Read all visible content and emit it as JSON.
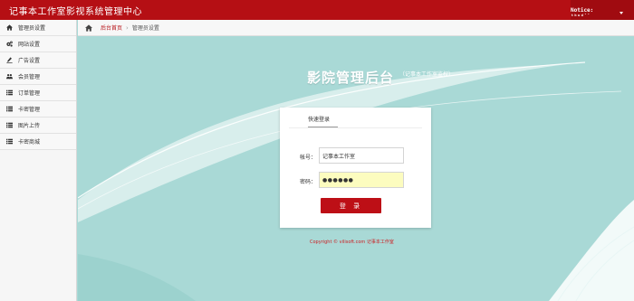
{
  "topbar": {
    "title": "记事本工作室影视系统管理中心",
    "notice": "Notice:　ᵗʰᵘᵈ˙˙"
  },
  "sidebar": {
    "items": [
      {
        "label": "管理员设置",
        "icon": "home-icon"
      },
      {
        "label": "网站设置",
        "icon": "gears-icon"
      },
      {
        "label": "广告设置",
        "icon": "pen-icon"
      },
      {
        "label": "会员管理",
        "icon": "users-icon"
      },
      {
        "label": "订单管理",
        "icon": "list-icon"
      },
      {
        "label": "卡密管理",
        "icon": "list-icon"
      },
      {
        "label": "图片上传",
        "icon": "list-icon"
      },
      {
        "label": "卡密商城",
        "icon": "list-icon"
      }
    ]
  },
  "breadcrumb": {
    "home_link": "后台首页",
    "separator": "›",
    "current": "管理员设置"
  },
  "login": {
    "heading": "影院管理后台",
    "subheading": "（记事本工作室监权）",
    "tab": "快速登录",
    "username_label": "帐号：",
    "username_value": "记事本工作室",
    "password_label": "密码：",
    "password_value": "●●●●●●",
    "submit": "登 录"
  },
  "footer": {
    "copyright": "Copyright © vilisoft.com 记事本工作室"
  },
  "colors": {
    "brand_red": "#b50f14",
    "background_teal": "#a9d9d6"
  }
}
